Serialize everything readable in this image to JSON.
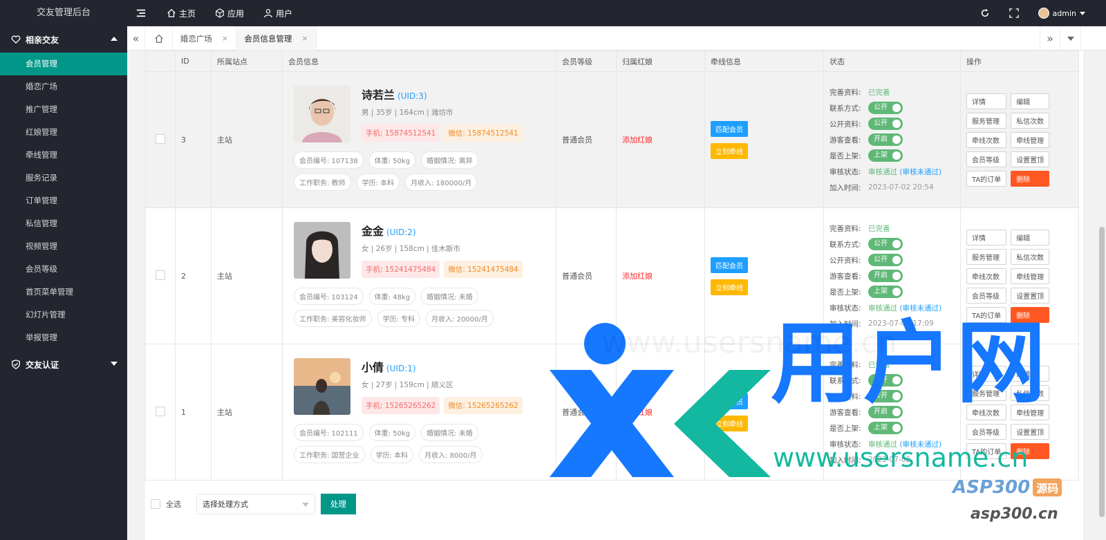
{
  "app": {
    "title": "交友管理后台"
  },
  "topnav": {
    "home": "主页",
    "apps": "应用",
    "users": "用户"
  },
  "user": {
    "name": "admin"
  },
  "sidebar": {
    "group1": "相亲交友",
    "items": [
      "会员管理",
      "婚恋广场",
      "推广管理",
      "红娘管理",
      "牵线管理",
      "服务记录",
      "订单管理",
      "私信管理",
      "视频管理",
      "会员等级",
      "首页菜单管理",
      "幻灯片管理",
      "举报管理"
    ],
    "active_index": 0,
    "group2": "交友认证"
  },
  "tabs": [
    "婚恋广场",
    "会员信息管理"
  ],
  "tabs_active": 1,
  "table": {
    "headers": [
      "ID",
      "所属站点",
      "会员信息",
      "会员等级",
      "归属红娘",
      "牵线信息",
      "状态",
      "操作"
    ],
    "rows": [
      {
        "id": "3",
        "site": "主站",
        "name": "诗若兰",
        "uid": "(UID:3)",
        "basic": "男 | 35岁 | 164cm | 潍坊市",
        "phone": "手机: 15874512541",
        "wechat": "微信: 15874512541",
        "chips1": [
          "会员编号: 107138",
          "体重: 50kg",
          "婚姻情况: 离异"
        ],
        "chips2": [
          "工作职务: 教师",
          "学历: 本科",
          "月收入: 180000/月"
        ],
        "level": "普通会员",
        "matchmaker": "添加红娘",
        "match_btn": "匹配会员",
        "link_btn": "立刻牵线",
        "status": {
          "profile_k": "完善资料:",
          "profile_v": "已完善",
          "contact_k": "联系方式:",
          "contact_v": "公开",
          "public_k": "公开资料:",
          "public_v": "公开",
          "guest_k": "游客查看:",
          "guest_v": "开启",
          "listed_k": "是否上架:",
          "listed_v": "上架",
          "audit_k": "审核状态:",
          "audit_ok": "审核通过",
          "audit_no": "(审核未通过)",
          "join_k": "加入时间:",
          "join_v": "2023-07-02 20:54"
        },
        "highlight": true
      },
      {
        "id": "2",
        "site": "主站",
        "name": "金金",
        "uid": "(UID:2)",
        "basic": "女 | 26岁 | 158cm | 佳木斯市",
        "phone": "手机: 15241475484",
        "wechat": "微信: 15241475484",
        "chips1": [
          "会员编号: 103124",
          "体重: 48kg",
          "婚姻情况: 未婚"
        ],
        "chips2": [
          "工作职务: 美容化妆师",
          "学历: 专科",
          "月收入: 20000/月"
        ],
        "level": "普通会员",
        "matchmaker": "添加红娘",
        "match_btn": "匹配会员",
        "link_btn": "立刻牵线",
        "status": {
          "profile_k": "完善资料:",
          "profile_v": "已完善",
          "contact_k": "联系方式:",
          "contact_v": "公开",
          "public_k": "公开资料:",
          "public_v": "公开",
          "guest_k": "游客查看:",
          "guest_v": "开启",
          "listed_k": "是否上架:",
          "listed_v": "上架",
          "audit_k": "审核状态:",
          "audit_ok": "审核通过",
          "audit_no": "(审核未通过)",
          "join_k": "加入时间:",
          "join_v": "2023-07-02 17:09"
        },
        "highlight": false
      },
      {
        "id": "1",
        "site": "主站",
        "name": "小倩",
        "uid": "(UID:1)",
        "basic": "女 | 27岁 | 159cm | 顺义区",
        "phone": "手机: 15265265262",
        "wechat": "微信: 15265265262",
        "chips1": [
          "会员编号: 102111",
          "体重: 50kg",
          "婚姻情况: 未婚"
        ],
        "chips2": [
          "工作职务: 国营企业",
          "学历: 本科",
          "月收入: 8000/月"
        ],
        "level": "普通会员",
        "matchmaker": "添加红娘",
        "match_btn": "匹配会员",
        "link_btn": "立刻牵线",
        "status": {
          "profile_k": "完善资料:",
          "profile_v": "已完善",
          "contact_k": "联系方式:",
          "contact_v": "公开",
          "public_k": "公开资料:",
          "public_v": "公开",
          "guest_k": "游客查看:",
          "guest_v": "开启",
          "listed_k": "是否上架:",
          "listed_v": "上架",
          "audit_k": "审核状态:",
          "audit_ok": "审核通过",
          "audit_no": "(审核未通过)",
          "join_k": "加入时间:",
          "join_v": "2023-07-02"
        },
        "highlight": false
      }
    ],
    "ops": [
      "详情",
      "编辑",
      "服务管理",
      "私信次数",
      "牵线次数",
      "牵线管理",
      "会员等级",
      "设置置顶",
      "TA的订单",
      "删除"
    ]
  },
  "footer": {
    "select_all": "全选",
    "select_placeholder": "选择处理方式",
    "process_btn": "处理"
  },
  "watermark": {
    "url": "www.usersname.cn",
    "brand": "用户网",
    "site2": "asp300.cn",
    "badge": "源码",
    "asp": "ASP300"
  },
  "colors": {
    "sidebar": "#23262e",
    "accent": "#009688",
    "blue": "#1e9fff",
    "orange": "#ffb800",
    "danger": "#ff5722",
    "ok": "#5fb878"
  }
}
